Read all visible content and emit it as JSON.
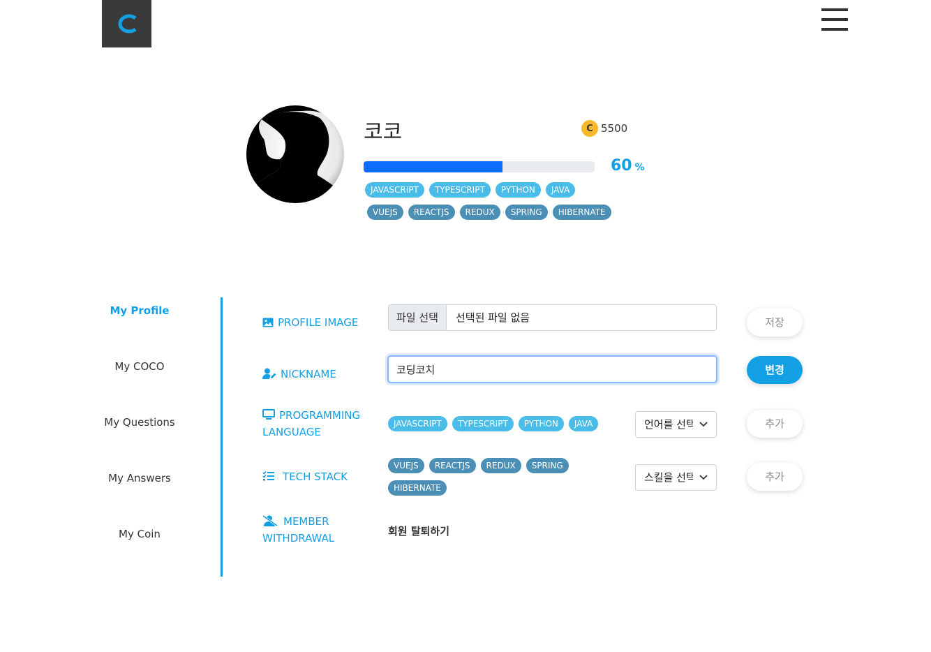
{
  "header": {
    "logo_letter": "C",
    "menu_icon": "hamburger-icon"
  },
  "profile": {
    "name": "코코",
    "coin_symbol": "C",
    "coin_amount": "5500",
    "progress_value": 60,
    "progress_label": "60",
    "progress_unit": "%",
    "languages": [
      "JAVASCRIPT",
      "TYPESCRIPT",
      "PYTHON",
      "JAVA"
    ],
    "stacks": [
      "VUEJS",
      "REACTJS",
      "REDUX",
      "SPRING",
      "HIBERNATE"
    ]
  },
  "sidebar": {
    "items": [
      {
        "label": "My Profile",
        "active": true
      },
      {
        "label": "My COCO"
      },
      {
        "label": "My Questions"
      },
      {
        "label": "My Answers"
      },
      {
        "label": "My Coin"
      }
    ]
  },
  "form": {
    "profile_image": {
      "label": "PROFILE IMAGE",
      "file_button": "파일 선택",
      "file_name": "선택된 파일 없음",
      "save_button": "저장"
    },
    "nickname": {
      "label": "NICKNAME",
      "value": "코딩코치",
      "change_button": "변경"
    },
    "programming_language": {
      "label_line1": "PROGRAMMING",
      "label_line2": "LANGUAGE",
      "select_value": "언어를 선택",
      "add_button": "추가"
    },
    "tech_stack": {
      "label": "TECH STACK",
      "select_value": "스킬을 선택",
      "add_button": "추가"
    },
    "withdrawal": {
      "label_line1": "MEMBER",
      "label_line2": "WITHDRAWAL",
      "link": "회원 탈퇴하기"
    }
  },
  "colors": {
    "accent": "#139fe3",
    "progress": "#0d6efd",
    "tag_language": "#49bce8",
    "tag_stack": "#4b8fb6",
    "coin": "#f7b92a",
    "logo_bg": "#3a3a3a"
  }
}
